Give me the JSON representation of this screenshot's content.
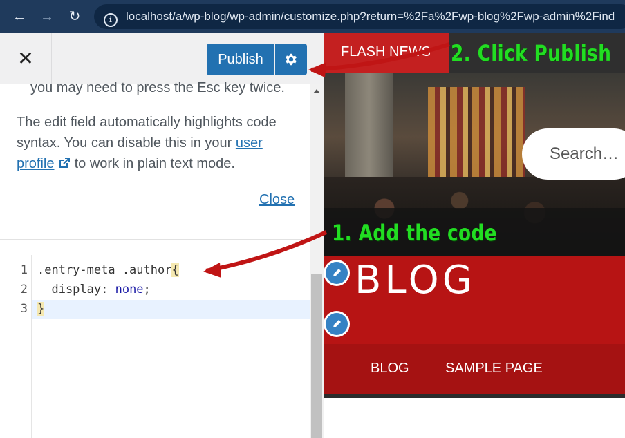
{
  "browser": {
    "back_icon": "←",
    "forward_icon": "→",
    "reload_icon": "↻",
    "info_icon": "i",
    "url": "localhost/a/wp-blog/wp-admin/customize.php?return=%2Fa%2Fwp-blog%2Fwp-admin%2Find"
  },
  "customizer": {
    "close_icon": "✕",
    "publish_label": "Publish",
    "help_line1": "you may need to press the Esc key twice.",
    "help_p2_a": "The edit field automatically highlights code syntax. You can disable this in your ",
    "help_link": "user profile",
    "help_p2_b": " to work in plain text mode.",
    "close_link": "Close"
  },
  "editor": {
    "line_numbers": [
      "1",
      "2",
      "3"
    ],
    "line1_selector": ".entry-meta .author",
    "line1_brace": "{",
    "line2_prop": "  display: ",
    "line2_value": "none",
    "line2_semi": ";",
    "line3": "}"
  },
  "preview": {
    "flash_news": "FLASH NEWS",
    "search_placeholder": "Search…",
    "site_title": "BLOG",
    "nav_items": [
      "BLOG",
      "SAMPLE PAGE"
    ]
  },
  "annotations": {
    "step1": "1. Add the code",
    "step2": "2. Click Publish"
  },
  "colors": {
    "annotation_green": "#22dd22",
    "arrow_red": "#c01515",
    "wp_blue": "#2271b1",
    "header_red": "#b71414"
  }
}
